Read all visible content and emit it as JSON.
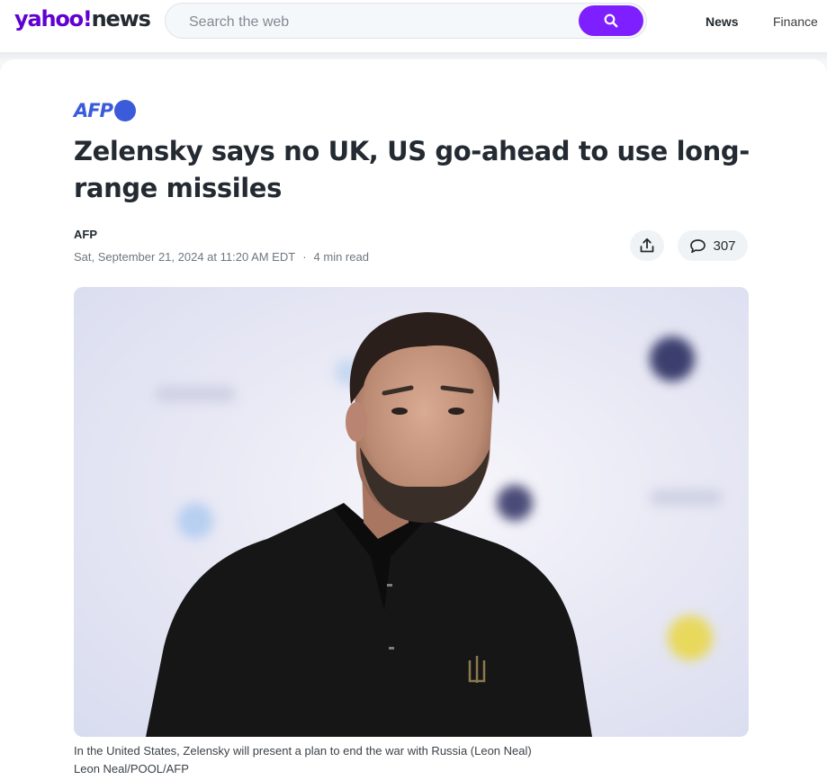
{
  "header": {
    "logo_main": "yahoo!",
    "logo_sub": "news",
    "search_placeholder": "Search the web",
    "nav": [
      "News",
      "Finance"
    ]
  },
  "article": {
    "source_logo": "AFP",
    "headline": "Zelensky says no UK, US go-ahead to use long-range missiles",
    "author": "AFP",
    "date": "Sat, September 21, 2024 at 11:20 AM EDT",
    "separator": "·",
    "read_time": "4 min read",
    "comment_count": "307",
    "caption": "In the United States, Zelensky will present a plan to end the war with Russia (Leon Neal)",
    "credit": "Leon Neal/POOL/AFP"
  },
  "colors": {
    "brand": "#6001d2",
    "search_button": "#7e1fff",
    "afp_blue": "#3b5bdb"
  },
  "icons": [
    "search-icon",
    "share-icon",
    "comment-icon"
  ]
}
